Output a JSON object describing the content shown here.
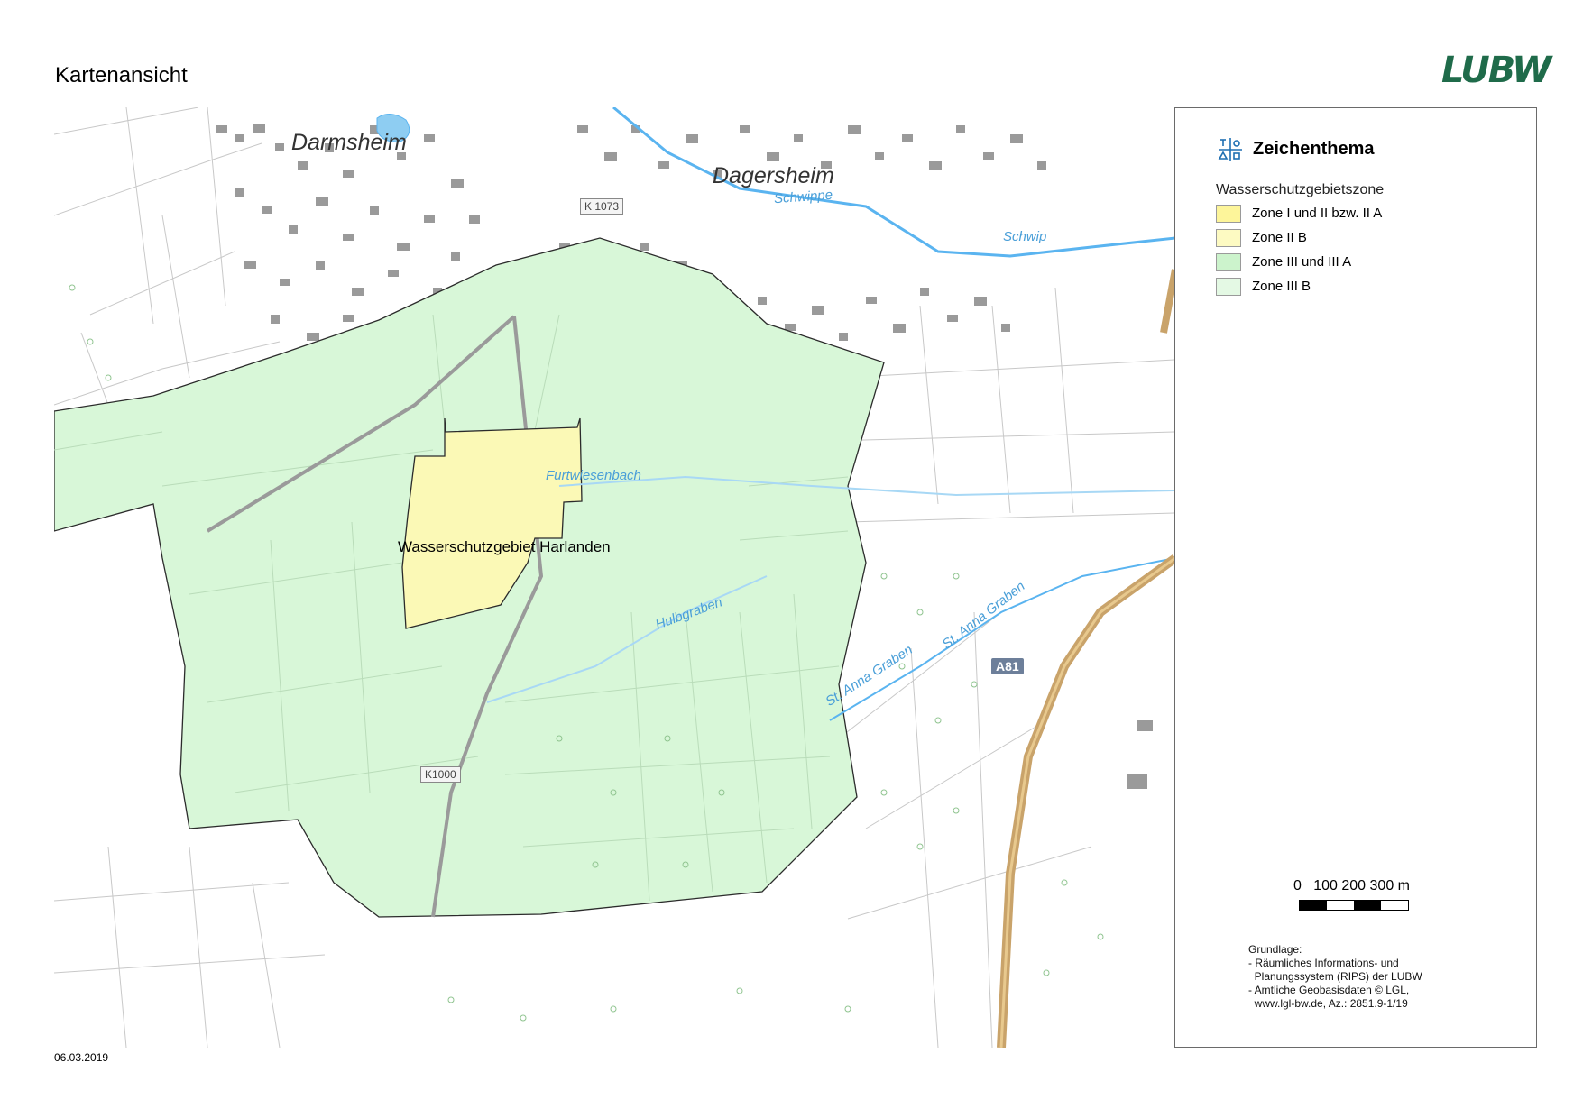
{
  "page": {
    "title": "Kartenansicht",
    "date": "06.03.2019"
  },
  "logo": {
    "text": "LUBW",
    "color": "#1f6b4a"
  },
  "map": {
    "places": [
      "Darmsheim",
      "Dagersheim"
    ],
    "roads": [
      "K 1073",
      "K1000"
    ],
    "highway": "A81",
    "waters": [
      "Schwippe",
      "Schwip",
      "Furtwiesenbach",
      "Hulbgraben",
      "St. Anna Graben",
      "St. Anna Graben"
    ],
    "protected_area_name": "Wasserschutzgebiet Harlanden"
  },
  "legend": {
    "title": "Zeichenthema",
    "icon": "drawing-theme-icon",
    "subtitle": "Wasserschutzgebietszone",
    "items": [
      {
        "label": "Zone I und II bzw. II A",
        "color": "#fdf59a"
      },
      {
        "label": "Zone II B",
        "color": "#fdfac2"
      },
      {
        "label": "Zone III und III A",
        "color": "#ccf3cc"
      },
      {
        "label": "Zone III B",
        "color": "#e4f9e4"
      }
    ]
  },
  "scale": {
    "labels": "0   100 200 300 m"
  },
  "source": {
    "heading": "Grundlage:",
    "lines": [
      "- Räumliches Informations- und",
      "  Planungssystem (RIPS) der LUBW",
      "- Amtliche Geobasisdaten © LGL,",
      "  www.lgl-bw.de, Az.: 2851.9-1/19"
    ]
  },
  "colors": {
    "zone3": "#d8f7d8",
    "zone1": "#fbf9b6",
    "water": "#5ab4f0",
    "highway": "#c9a36a",
    "building": "#8c8c8c"
  }
}
